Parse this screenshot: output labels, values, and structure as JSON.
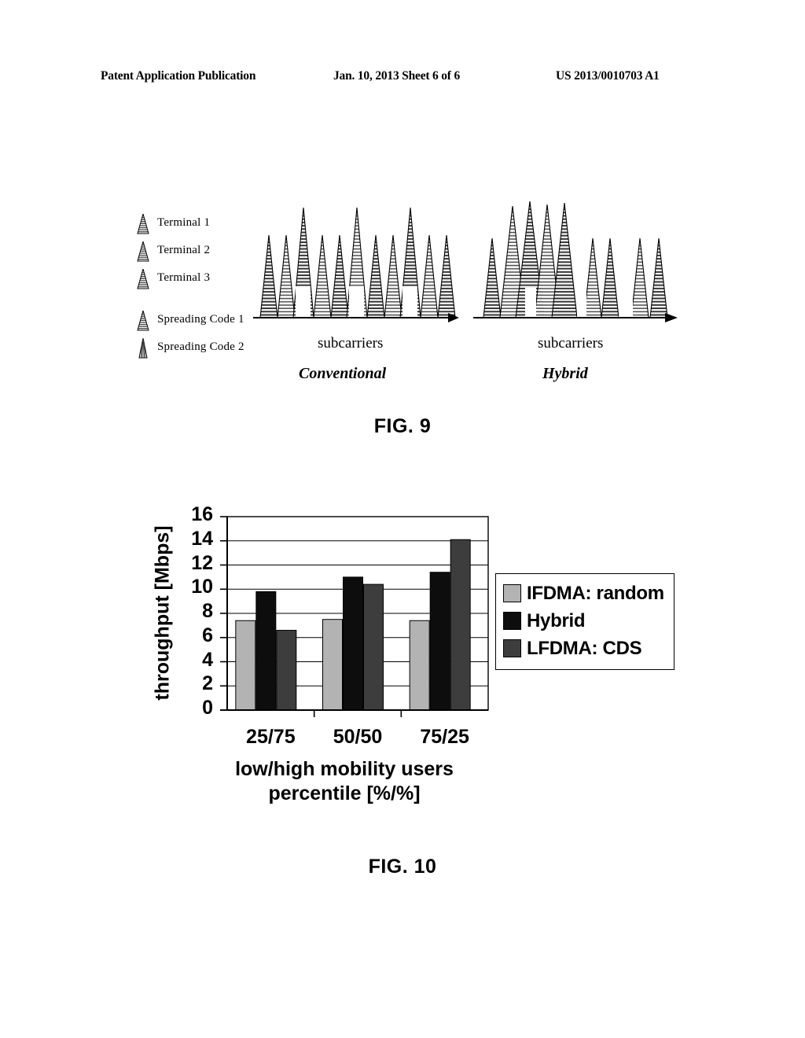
{
  "header": {
    "publication": "Patent Application Publication",
    "date_sheet": "Jan. 10, 2013  Sheet 6 of 6",
    "patent_number": "US 2013/0010703 A1"
  },
  "figure9": {
    "caption": "FIG. 9",
    "legend": [
      {
        "label": "Terminal 1",
        "icon": "striped-cone-icon"
      },
      {
        "label": "Terminal 2",
        "icon": "striped-cone-icon"
      },
      {
        "label": "Terminal 3",
        "icon": "striped-cone-icon"
      },
      {
        "label": "Spreading Code 1",
        "icon": "striped-cone-icon"
      },
      {
        "label": "Spreading Code 2",
        "icon": "vertical-lined-spike-icon"
      }
    ],
    "panels": [
      {
        "name": "Conventional",
        "axis_label": "subcarriers"
      },
      {
        "name": "Hybrid",
        "axis_label": "subcarriers"
      }
    ]
  },
  "figure10": {
    "caption": "FIG. 10"
  },
  "chart_data": {
    "type": "bar",
    "title": "",
    "categories": [
      "25/75",
      "50/50",
      "75/25"
    ],
    "series": [
      {
        "name": "IFDMA: random",
        "color": "#b3b3b3",
        "values": [
          7.4,
          7.5,
          7.4
        ]
      },
      {
        "name": "Hybrid",
        "color": "#0d0d0d",
        "values": [
          9.8,
          11.0,
          11.4
        ]
      },
      {
        "name": "LFDMA: CDS",
        "color": "#3d3d3d",
        "values": [
          6.6,
          10.4,
          14.1
        ]
      }
    ],
    "xlabel": "low/high mobility users percentile [%/%]",
    "xlabel_line1": "low/high mobility users",
    "xlabel_line2": "percentile [%/%]",
    "ylabel": "throughput [Mbps]",
    "ylim": [
      0,
      16
    ],
    "yticks": [
      16,
      14,
      12,
      10,
      8,
      6,
      4,
      2,
      0
    ],
    "grid": true,
    "legend_position": "right"
  }
}
